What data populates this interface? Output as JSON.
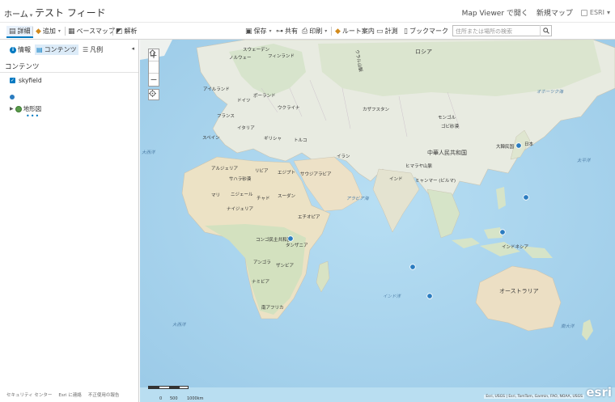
{
  "header": {
    "home_label": "ホーム",
    "map_title": "テスト フィード",
    "open_in_viewer": "Map Viewer で開く",
    "new_map": "新規マップ",
    "user_name": "ESRI"
  },
  "toolbar": {
    "details": "詳細",
    "add": "追加",
    "basemap": "ベースマップ",
    "analysis": "解析",
    "save": "保存",
    "share": "共有",
    "print": "印刷",
    "directions": "ルート案内",
    "measure": "計測",
    "bookmarks": "ブックマーク",
    "search_placeholder": "住所または場所の検索"
  },
  "sidebar": {
    "tabs": {
      "about": "情報",
      "contents": "コンテンツ",
      "legend": "凡例"
    },
    "contents_title": "コンテンツ",
    "layer_name": "skyfield",
    "basemap_name": "地形図",
    "more": "•••",
    "footer": [
      "セキュリティ センター",
      "Esri に連絡",
      "不正使用の報告"
    ]
  },
  "map": {
    "labels": {
      "russia": "ロシア",
      "sweden": "スウェーデン",
      "norway": "ノルウェー",
      "finland": "フィンランド",
      "ireland": "アイルランド",
      "germany": "ドイツ",
      "poland": "ポーランド",
      "ukraine": "ウクライナ",
      "france": "フランス",
      "italy": "イタリア",
      "spain": "スペイン",
      "greece": "ギリシャ",
      "turkey": "トルコ",
      "kazakhstan": "カザフスタン",
      "mongolia": "モンゴル",
      "gobi": "ゴビ砂漠",
      "china": "中華人民共和国",
      "himalaya": "ヒマラヤ山脈",
      "india": "インド",
      "myanmar": "ミャンマー (ビルマ)",
      "iran": "イラン",
      "saudi": "サウジアラビア",
      "egypt": "エジプト",
      "libya": "リビア",
      "algeria": "アルジェリア",
      "sahara": "サハラ砂漠",
      "mali": "マリ",
      "niger": "ニジェール",
      "chad": "チャド",
      "sudan": "スーダン",
      "nigeria": "ナイジェリア",
      "ethiopia": "エチオピア",
      "congo": "コンゴ民主共和国",
      "tanzania": "タンザニア",
      "angola": "アンゴラ",
      "zambia": "ザンビア",
      "namibia": "ナミビア",
      "south_africa": "南アフリカ",
      "indonesia": "インドネシア",
      "australia": "オーストラリア",
      "japan": "日本",
      "korea": "大韓民国",
      "arabian_sea": "アラビア海",
      "indian_ocean": "インド洋",
      "atlantic": "大西洋",
      "pacific": "太平洋",
      "okhotsk": "オホーツク海",
      "southern_ocean": "南大洋",
      "north_atlantic": "大西洋",
      "urals": "ウラル山脈"
    },
    "scale": {
      "s0": "0",
      "s1": "500",
      "s2": "1000km"
    },
    "attribution": "Esri, USGS | Esri, TomTom, Garmin, FAO, NOAA, USGS",
    "logo": "esri"
  }
}
